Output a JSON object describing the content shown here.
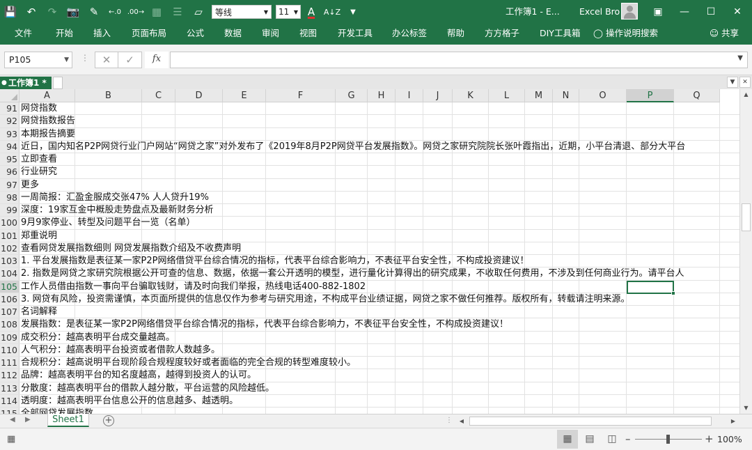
{
  "app": {
    "title": "工作簿1 - E...",
    "user": "Excel Bro",
    "font_name": "等线",
    "font_size": "11"
  },
  "ribbon_tabs": [
    "文件",
    "开始",
    "插入",
    "页面布局",
    "公式",
    "数据",
    "审阅",
    "视图",
    "开发工具",
    "办公标签",
    "帮助",
    "方方格子",
    "DIY工具箱",
    "操作说明搜索"
  ],
  "share_label": "共享",
  "formula_bar": {
    "name_box": "P105",
    "fx": "fx",
    "value": ""
  },
  "workbook_tab": "工作簿1 *",
  "columns": [
    "A",
    "B",
    "C",
    "D",
    "E",
    "F",
    "G",
    "H",
    "I",
    "J",
    "K",
    "L",
    "M",
    "N",
    "O",
    "P",
    "Q"
  ],
  "active_column": "P",
  "active_row": "105",
  "rows": [
    {
      "num": "91",
      "text": "网贷指数"
    },
    {
      "num": "92",
      "text": "网贷指数报告"
    },
    {
      "num": "93",
      "text": "本期报告摘要"
    },
    {
      "num": "94",
      "text": "近日，国内知名P2P网贷行业门户网站“网贷之家”对外发布了《2019年8月P2P网贷平台发展指数》。网贷之家研究院院长张叶霞指出，近期，小平台清退、部分大平台"
    },
    {
      "num": "95",
      "text": "立即查看"
    },
    {
      "num": "96",
      "text": "行业研究"
    },
    {
      "num": "97",
      "text": "更多"
    },
    {
      "num": "98",
      "text": "一周简报：汇盈金服成交张47% 人人贷升19%"
    },
    {
      "num": "99",
      "text": "深度：19家互金中概股走势盘点及最新财务分析"
    },
    {
      "num": "100",
      "text": "9月9家停业、转型及问题平台一览（名单）"
    },
    {
      "num": "101",
      "text": "郑重说明"
    },
    {
      "num": "102",
      "text": "查看网贷发展指数细则 网贷发展指数介绍及不收费声明"
    },
    {
      "num": "103",
      "text": "1. 平台发展指数是表征某一家P2P网络借贷平台综合情况的指标，代表平台综合影响力，不表征平台安全性，不构成投资建议！"
    },
    {
      "num": "104",
      "text": "2. 指数是网贷之家研究院根据公开可查的信息、数据，依据一套公开透明的模型，进行量化计算得出的研究成果，不收取任何费用，不涉及到任何商业行为。请平台人"
    },
    {
      "num": "105",
      "text": "工作人员借由指数一事向平台骗取钱财，请及时向我们举报，热线电话400-882-1802"
    },
    {
      "num": "106",
      "text": "3. 网贷有风险，投资需谨慎，本页面所提供的信息仅作为参考与研究用途，不构成平台业绩证据，网贷之家不做任何推荐。版权所有，转载请注明来源。"
    },
    {
      "num": "107",
      "text": "名词解释"
    },
    {
      "num": "108",
      "text": "发展指数：是表征某一家P2P网络借贷平台综合情况的指标，代表平台综合影响力，不表征平台安全性，不构成投资建议！"
    },
    {
      "num": "109",
      "text": "成交积分：越高表明平台成交量越高。"
    },
    {
      "num": "110",
      "text": "人气积分：越高表明平台投资或者借款人数越多。"
    },
    {
      "num": "111",
      "text": "合规积分：越高说明平台现阶段合规程度较好或者面临的完全合规的转型难度较小。"
    },
    {
      "num": "112",
      "text": "品牌：越高表明平台的知名度越高，越得到投资人的认可。"
    },
    {
      "num": "113",
      "text": "分散度：越高表明平台的借款人越分散，平台运营的风险越低。"
    },
    {
      "num": "114",
      "text": "透明度：越高表明平台信息公开的信息越多、越透明。"
    },
    {
      "num": "115",
      "text": "全部网贷发展指数"
    }
  ],
  "sheet_tab": "Sheet1",
  "status": {
    "zoom": "100%"
  }
}
